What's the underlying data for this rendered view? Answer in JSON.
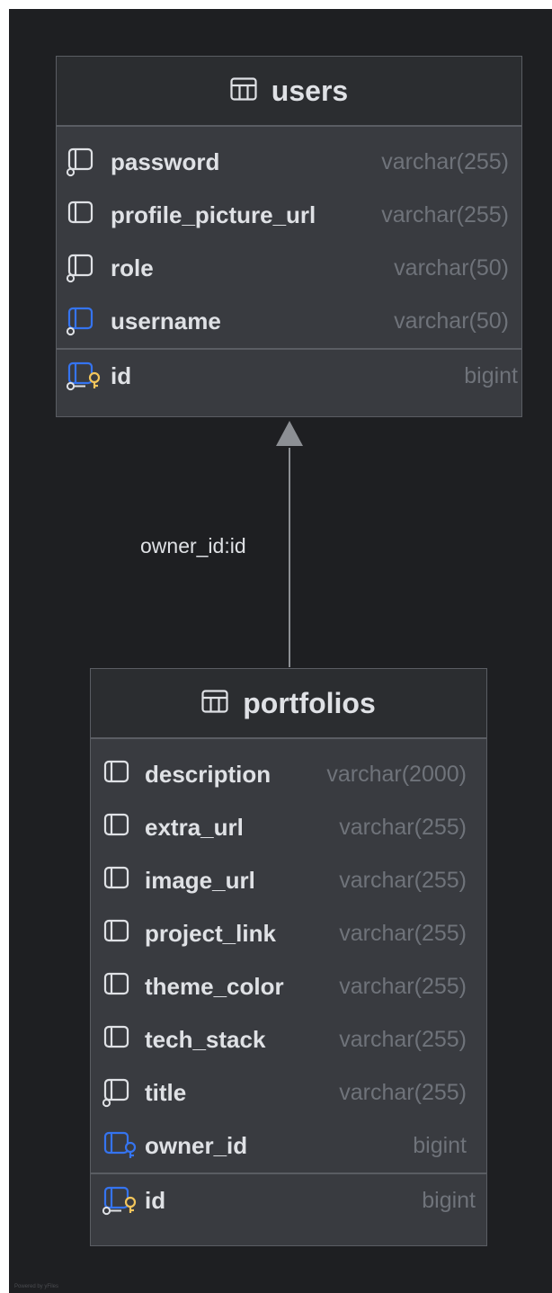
{
  "diagram": {
    "entities": [
      {
        "id": "users",
        "name": "users",
        "fields": [
          {
            "name": "password",
            "type": "varchar(255)",
            "icon": "column-not-null-icon",
            "color": "#dfe1e5"
          },
          {
            "name": "profile_picture_url",
            "type": "varchar(255)",
            "icon": "column-icon",
            "color": "#dfe1e5"
          },
          {
            "name": "role",
            "type": "varchar(50)",
            "icon": "column-not-null-icon",
            "color": "#dfe1e5"
          },
          {
            "name": "username",
            "type": "varchar(50)",
            "icon": "unique-column-icon",
            "color": "#3574f0"
          }
        ],
        "primary_key": {
          "name": "id",
          "type": "bigint",
          "icon": "primary-key-icon",
          "color": "#f2c55c"
        }
      },
      {
        "id": "portfolios",
        "name": "portfolios",
        "fields": [
          {
            "name": "description",
            "type": "varchar(2000)",
            "icon": "column-icon",
            "color": "#dfe1e5"
          },
          {
            "name": "extra_url",
            "type": "varchar(255)",
            "icon": "column-icon",
            "color": "#dfe1e5"
          },
          {
            "name": "image_url",
            "type": "varchar(255)",
            "icon": "column-icon",
            "color": "#dfe1e5"
          },
          {
            "name": "project_link",
            "type": "varchar(255)",
            "icon": "column-icon",
            "color": "#dfe1e5"
          },
          {
            "name": "theme_color",
            "type": "varchar(255)",
            "icon": "column-icon",
            "color": "#dfe1e5"
          },
          {
            "name": "tech_stack",
            "type": "varchar(255)",
            "icon": "column-icon",
            "color": "#dfe1e5"
          },
          {
            "name": "title",
            "type": "varchar(255)",
            "icon": "column-not-null-icon",
            "color": "#dfe1e5"
          },
          {
            "name": "owner_id",
            "type": "bigint",
            "icon": "foreign-key-icon",
            "color": "#3574f0"
          }
        ],
        "primary_key": {
          "name": "id",
          "type": "bigint",
          "icon": "primary-key-icon",
          "color": "#f2c55c"
        }
      }
    ],
    "relationships": [
      {
        "from": "portfolios",
        "to": "users",
        "label": "owner_id:id"
      }
    ],
    "credit": "Powered by yFiles"
  }
}
